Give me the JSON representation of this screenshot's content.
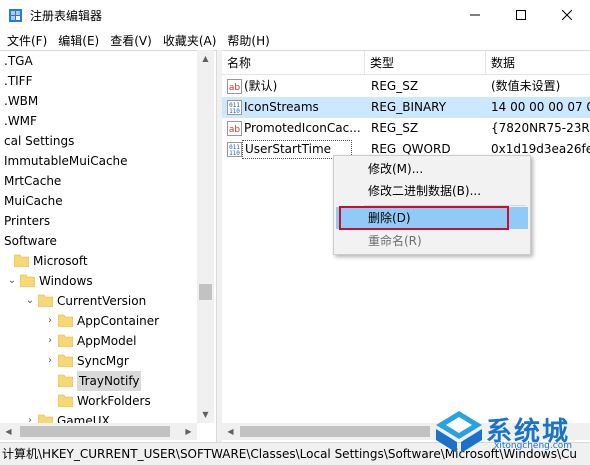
{
  "window": {
    "title": "注册表编辑器",
    "controls": {
      "minimize": "—",
      "maximize": "☐",
      "close": "✕"
    }
  },
  "menu": [
    "文件(F)",
    "编辑(E)",
    "查看(V)",
    "收藏夹(A)",
    "帮助(H)"
  ],
  "tree": {
    "items": [
      {
        "label": ".TGA",
        "folder": false,
        "expander": ""
      },
      {
        "label": ".TIFF",
        "folder": false,
        "expander": ""
      },
      {
        "label": ".WBM",
        "folder": false,
        "expander": ""
      },
      {
        "label": ".WMF",
        "folder": false,
        "expander": ""
      },
      {
        "label": "cal Settings",
        "folder": false,
        "expander": ""
      },
      {
        "label": "ImmutableMuiCache",
        "folder": false,
        "expander": ""
      },
      {
        "label": "MrtCache",
        "folder": false,
        "expander": ""
      },
      {
        "label": "MuiCache",
        "folder": false,
        "expander": ""
      },
      {
        "label": "Printers",
        "folder": false,
        "expander": ""
      },
      {
        "label": "Software",
        "folder": false,
        "expander": ""
      },
      {
        "label": "Microsoft",
        "folder": true,
        "expander": ""
      },
      {
        "label": "Windows",
        "folder": true,
        "expander": "v"
      },
      {
        "label": "CurrentVersion",
        "folder": true,
        "expander": "v"
      },
      {
        "label": "AppContainer",
        "folder": true,
        "expander": ">"
      },
      {
        "label": "AppModel",
        "folder": true,
        "expander": ">"
      },
      {
        "label": "SyncMgr",
        "folder": true,
        "expander": ">"
      },
      {
        "label": "TrayNotify",
        "folder": true,
        "expander": "",
        "selected": true
      },
      {
        "label": "WorkFolders",
        "folder": true,
        "expander": ""
      },
      {
        "label": "GameUX",
        "folder": true,
        "expander": ">"
      }
    ]
  },
  "list": {
    "columns": [
      "名称",
      "类型",
      "数据"
    ],
    "rows": [
      {
        "icon": "string-value-icon",
        "name": "(默认)",
        "type": "REG_SZ",
        "data": "(数值未设置)"
      },
      {
        "icon": "binary-value-icon",
        "name": "IconStreams",
        "type": "REG_BINARY",
        "data": "14 00 00 00 07 0",
        "selected": true
      },
      {
        "icon": "string-value-icon",
        "name": "PromotedIconCac...",
        "type": "REG_SZ",
        "data": "{7820NR75-23R3"
      },
      {
        "icon": "binary-value-icon",
        "name": "UserStartTime",
        "type": "REG_QWORD",
        "data": "0x1d19d3ea26fe",
        "focused": true
      }
    ]
  },
  "context_menu": {
    "items": [
      {
        "label": "修改(M)...",
        "disabled": false
      },
      {
        "label": "修改二进制数据(B)...",
        "disabled": false
      },
      {
        "label": "删除(D)",
        "disabled": false,
        "highlighted": true
      },
      {
        "label": "重命名(R)",
        "disabled": true
      }
    ]
  },
  "statusbar": {
    "path": "计算机\\HKEY_CURRENT_USER\\SOFTWARE\\Classes\\Local Settings\\Software\\Microsoft\\Windows\\Cu"
  },
  "watermark": {
    "text": "系统城",
    "sub": "xitongcheng.com"
  },
  "colors": {
    "selection": "#cce8ff",
    "menu_highlight": "#91c9f7",
    "annotation_red": "#c8102e",
    "folder": "#f8d775",
    "watermark": "#1a73c8"
  }
}
